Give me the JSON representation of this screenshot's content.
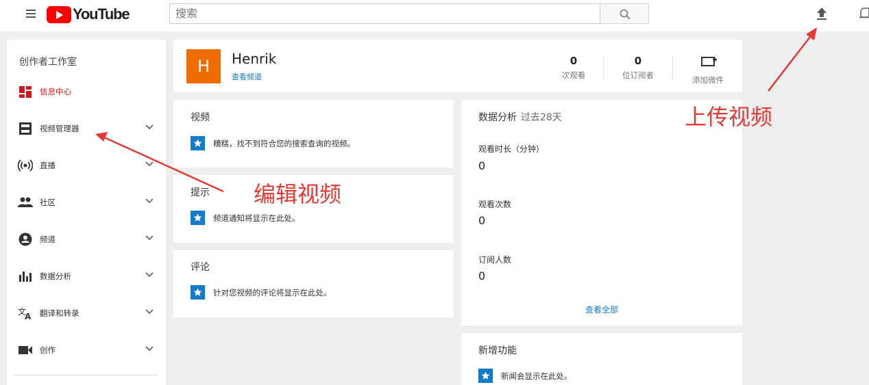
{
  "header": {
    "logo_text": "YouTube",
    "search_placeholder": "搜索"
  },
  "sidebar": {
    "title": "创作者工作室",
    "items": [
      {
        "label": "信息中心",
        "icon": "dashboard-icon",
        "active": true
      },
      {
        "label": "视频管理器",
        "icon": "video-manager-icon"
      },
      {
        "label": "直播",
        "icon": "live-icon"
      },
      {
        "label": "社区",
        "icon": "community-icon"
      },
      {
        "label": "频道",
        "icon": "channel-icon"
      },
      {
        "label": "数据分析",
        "icon": "analytics-icon"
      },
      {
        "label": "翻译和转录",
        "icon": "translate-icon"
      },
      {
        "label": "创作",
        "icon": "create-icon"
      }
    ]
  },
  "profile": {
    "avatar_letter": "H",
    "name": "Henrik",
    "view_channel": "查看频道",
    "stats": [
      {
        "value": "0",
        "label": "次观看"
      },
      {
        "value": "0",
        "label": "位订阅者"
      }
    ],
    "add_widget": "添加微件"
  },
  "videos_card": {
    "title": "视频",
    "message": "糟糕，找不到符合您的搜索查询的视频。"
  },
  "tips_card": {
    "title": "提示",
    "message": "频道通知将显示在此处。"
  },
  "comments_card": {
    "title": "评论",
    "message": "针对您视频的评论将显示在此处。"
  },
  "analytics_card": {
    "title": "数据分析",
    "period": "过去28天",
    "metrics": [
      {
        "label": "观看时长（分钟）",
        "value": "0"
      },
      {
        "label": "观看次数",
        "value": "0"
      },
      {
        "label": "订阅人数",
        "value": "0"
      }
    ],
    "see_all": "查看全部"
  },
  "news_card": {
    "title": "新增功能",
    "message": "新闻会显示在此处。"
  },
  "annotations": {
    "upload": "上传视频",
    "edit": "编辑视频"
  },
  "colors": {
    "accent_blue": "#167ac6",
    "youtube_red": "#ff0000",
    "avatar_orange": "#ef6c00",
    "annotation_red": "#e53935"
  }
}
